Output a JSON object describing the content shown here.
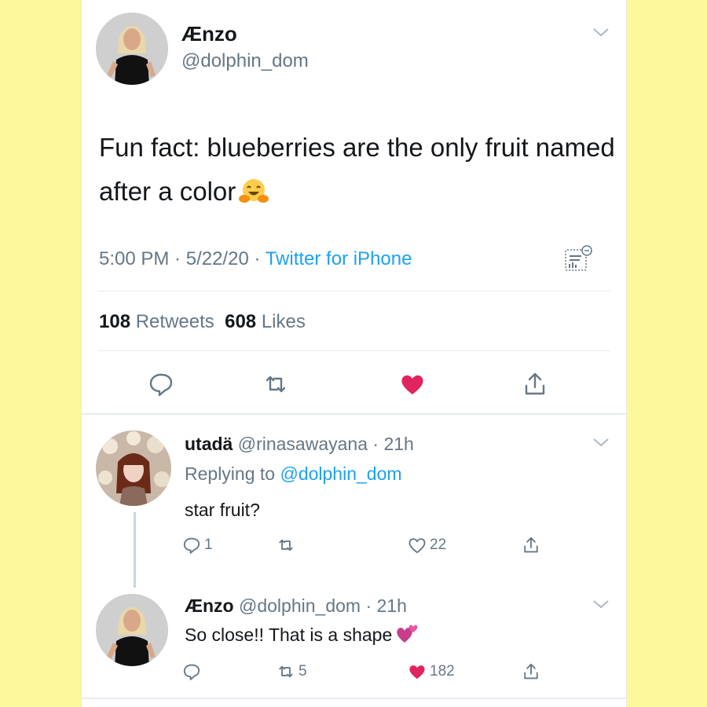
{
  "main_tweet": {
    "name": "Ænzo",
    "handle": "@dolphin_dom",
    "text": "Fun fact: blueberries are the only fruit named after a color",
    "emoji": "hugging-face",
    "time": "5:00 PM",
    "date": "5/22/20",
    "source": "Twitter for iPhone",
    "retweets_count": "108",
    "retweets_label": "Retweets",
    "likes_count": "608",
    "likes_label": "Likes",
    "liked": true,
    "colors": {
      "like_red": "#e0245e",
      "link_blue": "#1da1f2",
      "muted_gray": "#657786"
    }
  },
  "replies": [
    {
      "name": "utadä",
      "handle": "@rinasawayana",
      "age": "21h",
      "replying_prefix": "Replying to",
      "replying_to": "@dolphin_dom",
      "text": "star fruit?",
      "reply_count": "1",
      "retweet_count": "",
      "like_count": "22",
      "liked": false
    },
    {
      "name": "Ænzo",
      "handle": "@dolphin_dom",
      "age": "21h",
      "text": "So close!! That is a shape",
      "emoji": "two-hearts",
      "reply_count": "",
      "retweet_count": "5",
      "like_count": "182",
      "liked": true
    }
  ],
  "sep": " · "
}
